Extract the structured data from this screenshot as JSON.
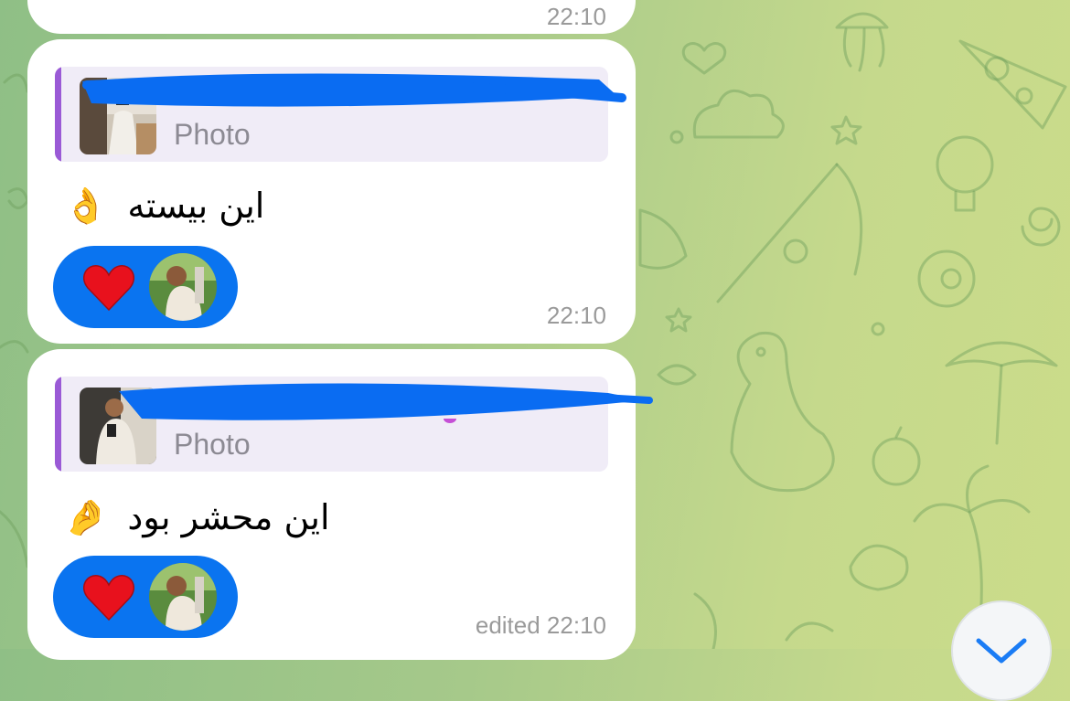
{
  "colors": {
    "bubble": "#ffffff",
    "reply_background": "#f0ecf7",
    "reply_accent": "#9a5ad6",
    "reaction_pill": "#0a74f0",
    "timestamp": "#9a9a9a",
    "redaction": "#0a6cf2"
  },
  "previous_message": {
    "time": "22:10"
  },
  "messages": [
    {
      "reply": {
        "label": "Photo",
        "thumb_icon": "photo-thumbnail"
      },
      "text": "این بیسته",
      "emoji": "👌",
      "reaction": {
        "emoji": "❤",
        "reactor_icon": "user-avatar"
      },
      "time": "22:10"
    },
    {
      "reply": {
        "label": "Photo",
        "thumb_icon": "photo-thumbnail"
      },
      "text": "این محشر بود",
      "emoji": "🤌",
      "reaction": {
        "emoji": "❤",
        "reactor_icon": "user-avatar"
      },
      "time": "edited 22:10"
    }
  ],
  "scroll_down": {
    "icon": "chevron-down-icon"
  }
}
